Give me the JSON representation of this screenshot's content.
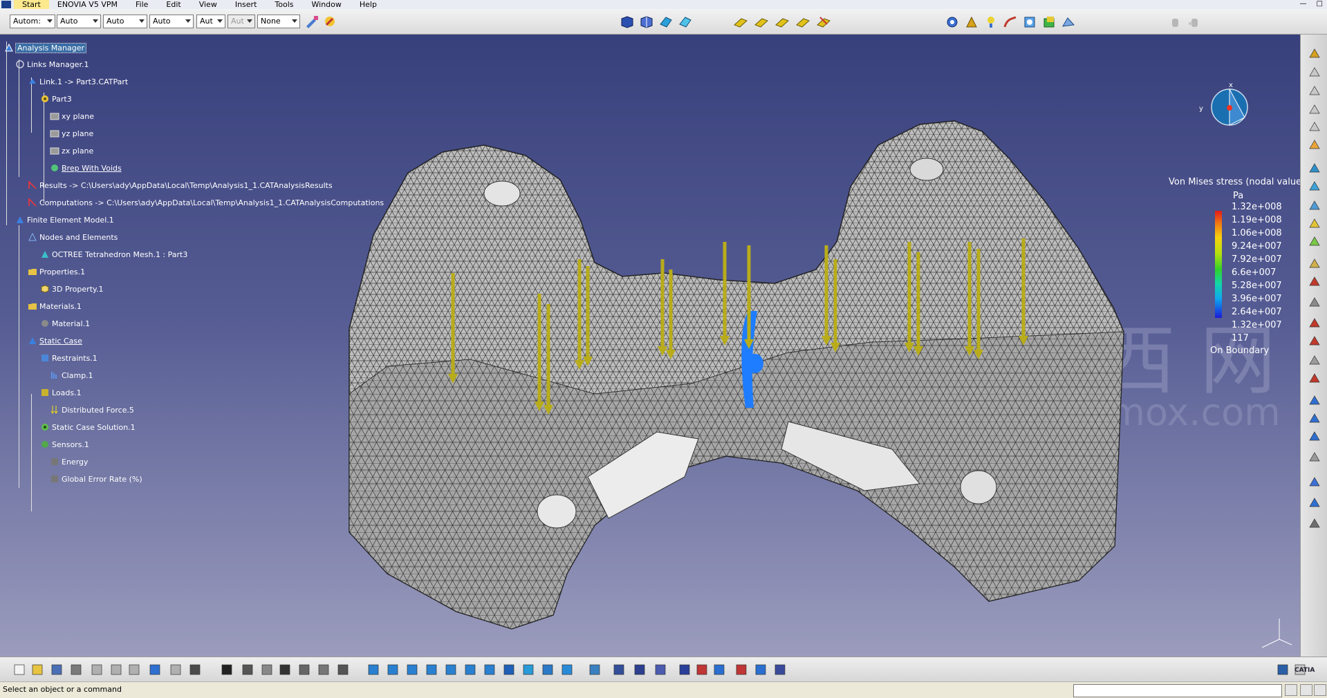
{
  "menubar": {
    "items": [
      "Start",
      "ENOVIA V5 VPM",
      "File",
      "Edit",
      "View",
      "Insert",
      "Tools",
      "Window",
      "Help"
    ]
  },
  "toolbar": {
    "combos": [
      "Autom:",
      "Auto",
      "Auto",
      "Auto",
      "Aut",
      "Aut",
      "None"
    ]
  },
  "tree": {
    "root": "Analysis Manager",
    "links_manager": "Links Manager.1",
    "link1": "Link.1 -> Part3.CATPart",
    "part3": "Part3",
    "xy_plane": "xy plane",
    "yz_plane": "yz plane",
    "zx_plane": "zx plane",
    "brep": "Brep With Voids",
    "results": "Results -> C:\\Users\\ady\\AppData\\Local\\Temp\\Analysis1_1.CATAnalysisResults",
    "computations": "Computations -> C:\\Users\\ady\\AppData\\Local\\Temp\\Analysis1_1.CATAnalysisComputations",
    "fem": "Finite Element Model.1",
    "nodes": "Nodes and Elements",
    "mesh": "OCTREE Tetrahedron Mesh.1 : Part3",
    "properties": "Properties.1",
    "property3d": "3D Property.1",
    "materials": "Materials.1",
    "material1": "Material.1",
    "static_case": "Static Case",
    "restraints": "Restraints.1",
    "clamp": "Clamp.1",
    "loads": "Loads.1",
    "force": "Distributed Force.5",
    "solution": "Static Case Solution.1",
    "sensors": "Sensors.1",
    "energy": "Energy",
    "error_rate": "Global Error Rate (%)"
  },
  "legend": {
    "title": "Von Mises stress (nodal values)",
    "unit": "Pa",
    "values": [
      "1.32e+008",
      "1.19e+008",
      "1.06e+008",
      "9.24e+007",
      "7.92e+007",
      "6.6e+007",
      "5.28e+007",
      "3.96e+007",
      "2.64e+007",
      "1.32e+007",
      "117"
    ],
    "footer": "On Boundary",
    "compass_x": "x",
    "compass_y": "y"
  },
  "watermark": {
    "chars": "西 网",
    "url": "www.3dmox.com"
  },
  "status": {
    "text": "Select an object or a command",
    "command_value": ""
  },
  "brand": "CATIA",
  "colors": {
    "background_top": "#38407c",
    "background_bottom": "#9b9cbd",
    "force_arrow": "#b8ac1a",
    "clamp": "#1e7cff",
    "selection": "#3a6ea5"
  }
}
